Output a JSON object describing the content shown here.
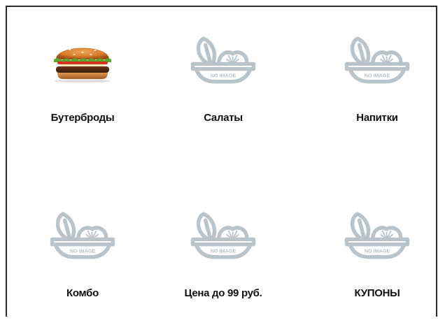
{
  "categories": [
    {
      "label": "Бутерброды",
      "image": "burger-photo"
    },
    {
      "label": "Салаты",
      "image": "no-image-placeholder",
      "placeholder_text": "NO IMAGE"
    },
    {
      "label": "Напитки",
      "image": "no-image-placeholder",
      "placeholder_text": "NO IMAGE"
    },
    {
      "label": "Комбо",
      "image": "no-image-placeholder",
      "placeholder_text": "NO IMAGE"
    },
    {
      "label": "Цена до 99 руб.",
      "image": "no-image-placeholder",
      "placeholder_text": "NO IMAGE"
    },
    {
      "label": "КУПОНЫ",
      "image": "no-image-placeholder",
      "placeholder_text": "NO IMAGE"
    }
  ],
  "colors": {
    "placeholder": "#b9c3ca",
    "label": "#111111",
    "border": "#2a2a2a"
  }
}
